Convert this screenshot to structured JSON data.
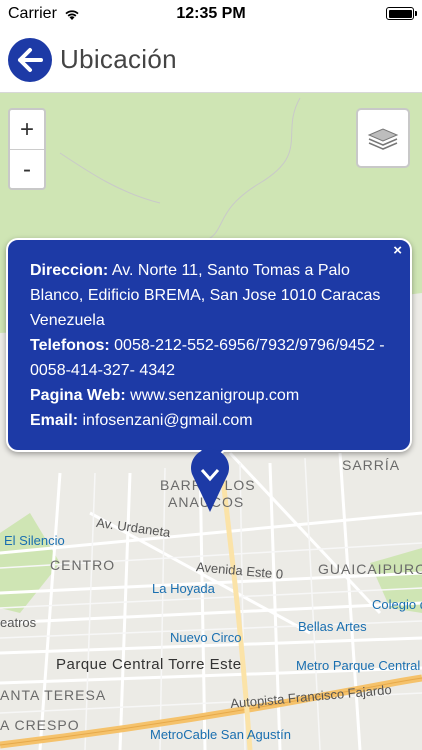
{
  "status_bar": {
    "carrier": "Carrier",
    "time": "12:35 PM"
  },
  "header": {
    "title": "Ubicación"
  },
  "map_controls": {
    "zoom_in": "+",
    "zoom_out": "-"
  },
  "popup": {
    "close": "×",
    "direccion_label": "Direccion:",
    "direccion": "Av. Norte 11, Santo Tomas a Palo Blanco, Edificio BREMA, San Jose 1010 Caracas Venezuela",
    "telefonos_label": "Telefonos:",
    "telefonos": "0058-212-552-6956/7932/9796/9452 - 0058-414-327- 4342",
    "web_label": "Pagina Web:",
    "web": "www.senzanigroup.com",
    "email_label": "Email:",
    "email": "infosenzani@gmail.com"
  },
  "map_labels": {
    "sarria": "SARRÍA",
    "barrio_los": "BARRIO LOS",
    "anaucos": "ANAUCOS",
    "av_urdaneta": "Av. Urdaneta",
    "el_silencio": "El Silencio",
    "centro": "CENTRO",
    "avenida_este0": "Avenida Este 0",
    "guaicaipuro": "GUAICAIPURO",
    "la_hoyada": "La Hoyada",
    "colegio": "Colegio d",
    "teatros": "eatros",
    "bellas_artes": "Bellas Artes",
    "nuevo_circo": "Nuevo Circo",
    "parque_central": "Parque Central Torre Este",
    "metro_parque": "Metro Parque Central",
    "santa_teresa": "ANTA TERESA",
    "autopista": "Autopista Francisco Fajardo",
    "crespo": "A CRESPO",
    "metrocable": "MetroCable San Agustín"
  },
  "colors": {
    "brand_blue": "#1d3aa6",
    "park_green": "#cfe5b4",
    "highway_orange": "#f5c26b"
  }
}
